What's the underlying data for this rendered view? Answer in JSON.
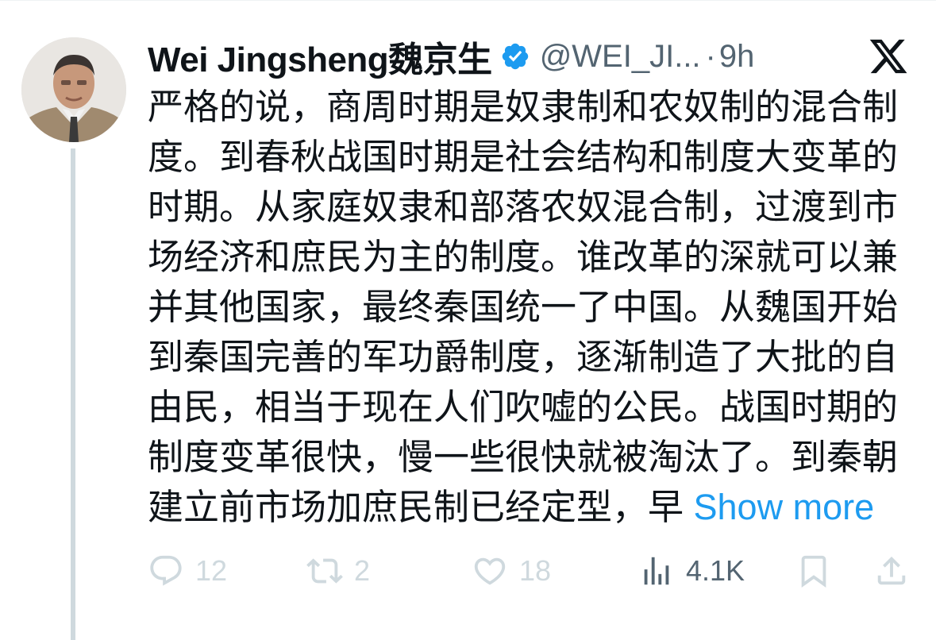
{
  "author": {
    "name": "Wei Jingsheng魏京生",
    "handle": "@WEI_JI...",
    "separator": "·",
    "time": "9h"
  },
  "tweet": {
    "text": "严格的说，商周时期是奴隶制和农奴制的混合制度。到春秋战国时期是社会结构和制度大变革的时期。从家庭奴隶和部落农奴混合制，过渡到市场经济和庶民为主的制度。谁改革的深就可以兼并其他国家，最终秦国统一了中国。从魏国开始到秦国完善的军功爵制度，逐渐制造了大批的自由民，相当于现在人们吹嘘的公民。战国时期的制度变革很快，慢一些很快就被淘汰了。到秦朝建立前市场加庶民制已经定型，早 ",
    "show_more": "Show more"
  },
  "actions": {
    "replies": "12",
    "retweets": "2",
    "likes": "18",
    "views": "4.1K"
  },
  "icons": {
    "verified": "verified-badge-icon",
    "logo": "x-logo-icon",
    "reply": "reply-icon",
    "retweet": "retweet-icon",
    "like": "heart-icon",
    "views": "views-icon",
    "bookmark": "bookmark-icon",
    "share": "share-icon"
  },
  "colors": {
    "text": "#0f1419",
    "secondary": "#536471",
    "link": "#1d9bf0",
    "muted_action": "#cfd9de",
    "verified": "#1d9bf0"
  }
}
